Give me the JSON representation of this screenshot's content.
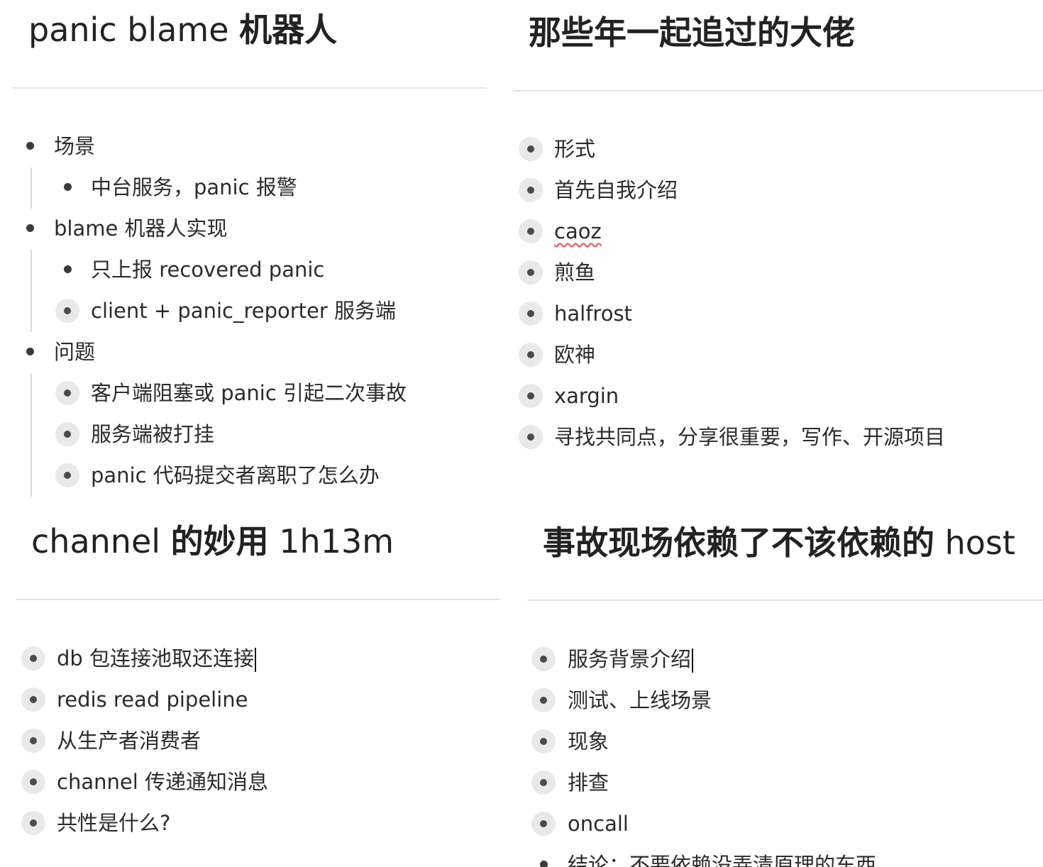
{
  "panel_tl": {
    "title_latin": "panic blame ",
    "title_cjk": "机器人",
    "items": [
      {
        "text": "场景"
      },
      {
        "text": "中台服务，panic 报警"
      },
      {
        "text": "blame 机器人实现"
      },
      {
        "text": "只上报 recovered panic"
      },
      {
        "text": "client + panic_reporter 服务端"
      },
      {
        "text": "问题"
      },
      {
        "text": "客户端阻塞或 panic 引起二次事故"
      },
      {
        "text": "服务端被打挂"
      },
      {
        "text": "panic 代码提交者离职了怎么办"
      }
    ]
  },
  "panel_tr": {
    "title": "那些年一起追过的大佬",
    "items": [
      {
        "text": "形式"
      },
      {
        "text": "首先自我介绍"
      },
      {
        "text": "caoz"
      },
      {
        "text": "煎鱼"
      },
      {
        "text": "halfrost"
      },
      {
        "text": "欧神"
      },
      {
        "text": "xargin"
      },
      {
        "text": "寻找共同点，分享很重要，写作、开源项目"
      }
    ]
  },
  "panel_bl": {
    "title_a": "channel ",
    "title_cjk": "的妙用",
    "title_b": " 1h13m",
    "items": [
      {
        "text": "db 包连接池取还连接"
      },
      {
        "text": "redis read pipeline"
      },
      {
        "text": "从生产者消费者"
      },
      {
        "text": "channel 传递通知消息"
      },
      {
        "text": "共性是什么?"
      }
    ]
  },
  "panel_br": {
    "title_cjk": "事故现场依赖了不该依赖的",
    "title_latin": " host",
    "items": [
      {
        "text": "服务背景介绍"
      },
      {
        "text": "测试、上线场景"
      },
      {
        "text": "现象"
      },
      {
        "text": "排查"
      },
      {
        "text": "oncall"
      },
      {
        "text": "结论：不要依赖没弄清原理的东西"
      }
    ]
  }
}
